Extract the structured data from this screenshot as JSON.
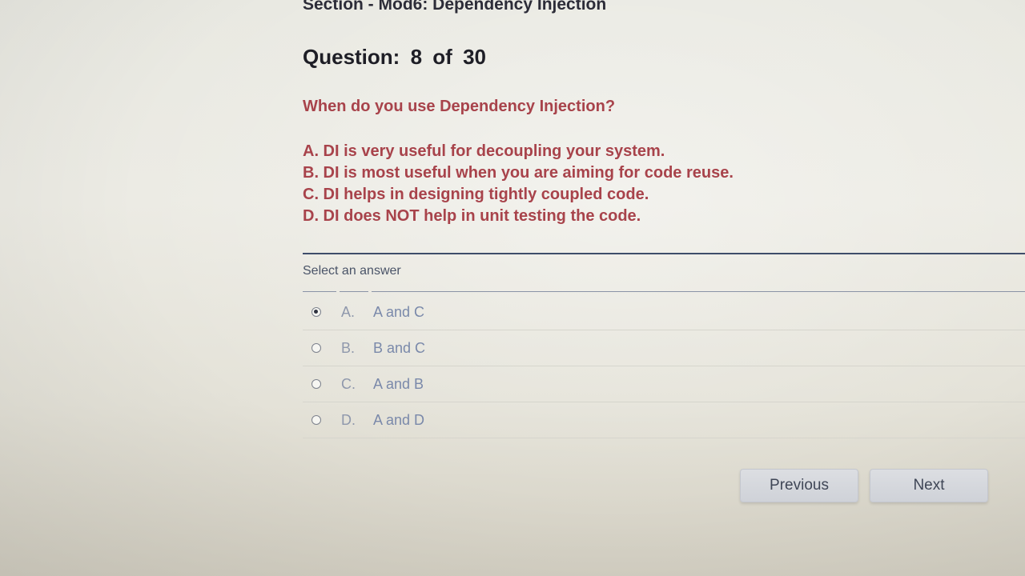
{
  "header": {
    "section_title": "Section - Mod6: Dependency Injection"
  },
  "question": {
    "label": "Question:",
    "number": "8",
    "of_label": "of",
    "total": "30",
    "text": "When do you use Dependency Injection?",
    "statements": [
      "A. DI is very useful for decoupling your system.",
      "B. DI is most useful when you are aiming for code reuse.",
      "C. DI helps in designing tightly coupled code.",
      "D. DI does NOT help in unit testing the code."
    ]
  },
  "answers": {
    "label": "Select an answer",
    "selected": "A",
    "options": [
      {
        "letter": "A.",
        "text": "A and C"
      },
      {
        "letter": "B.",
        "text": "B and C"
      },
      {
        "letter": "C.",
        "text": "A and B"
      },
      {
        "letter": "D.",
        "text": "A and D"
      }
    ]
  },
  "navigation": {
    "previous_label": "Previous",
    "next_label": "Next"
  }
}
